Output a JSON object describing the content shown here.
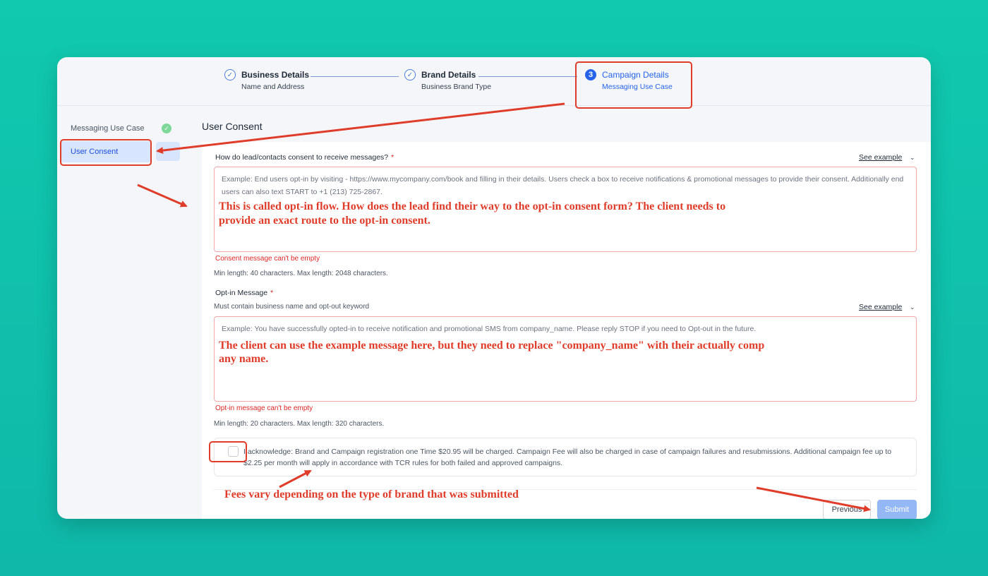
{
  "stepper": {
    "steps": [
      {
        "title": "Business Details",
        "subtitle": "Name and Address",
        "marker": "✓"
      },
      {
        "title": "Brand Details",
        "subtitle": "Business Brand Type",
        "marker": "✓"
      },
      {
        "title": "Campaign Details",
        "subtitle": "Messaging Use Case",
        "marker": "3"
      }
    ]
  },
  "sidebar": {
    "items": [
      {
        "label": "Messaging Use Case"
      },
      {
        "label": "User Consent"
      }
    ]
  },
  "section_title": "User Consent",
  "consent": {
    "label": "How do lead/contacts consent to receive messages?",
    "required": "*",
    "see_example": "See example",
    "placeholder": "Example: End users opt-in by visiting - https://www.mycompany.com/book and filling in their details. Users check a box to receive notifications & promotional messages to provide their consent. Additionally end users can also text START to +1 (213) 725-2867.",
    "error": "Consent message can't be empty",
    "hint": "Min length: 40 characters. Max length: 2048 characters."
  },
  "optin": {
    "label": "Opt-in Message",
    "required": "*",
    "sublabel": "Must contain business name and opt-out keyword",
    "see_example": "See example",
    "placeholder": "Example: You have successfully opted-in to receive notification and promotional SMS from company_name. Please reply STOP if you need to Opt-out in the future.",
    "error": "Opt-in message can't be empty",
    "hint": "Min length: 20 characters. Max length: 320 characters."
  },
  "acknowledge": {
    "text": "I acknowledge: Brand and Campaign registration one Time $20.95 will be charged. Campaign Fee will also be charged in case of campaign failures and resubmissions. Additional campaign fee up to $2.25 per month will apply in accordance with TCR rules for both failed and approved campaigns."
  },
  "buttons": {
    "previous": "Previous",
    "submit": "Submit"
  },
  "annotations": {
    "consent_note_line1": "This is called opt-in flow. How does the lead find their way to the opt-in consent form? The client needs to",
    "consent_note_line2": "provide an exact route to the opt-in consent.",
    "optin_note_line1": "The client can use the example message here, but they need to replace \"company_name\" with their actually comp",
    "optin_note_line2": "any name.",
    "fees_note": "Fees vary depending on the type of brand that was submitted"
  },
  "colors": {
    "accent": "#2563eb",
    "annotation": "#e03c2a",
    "error": "#dc2626",
    "background": "#10c9ae"
  }
}
